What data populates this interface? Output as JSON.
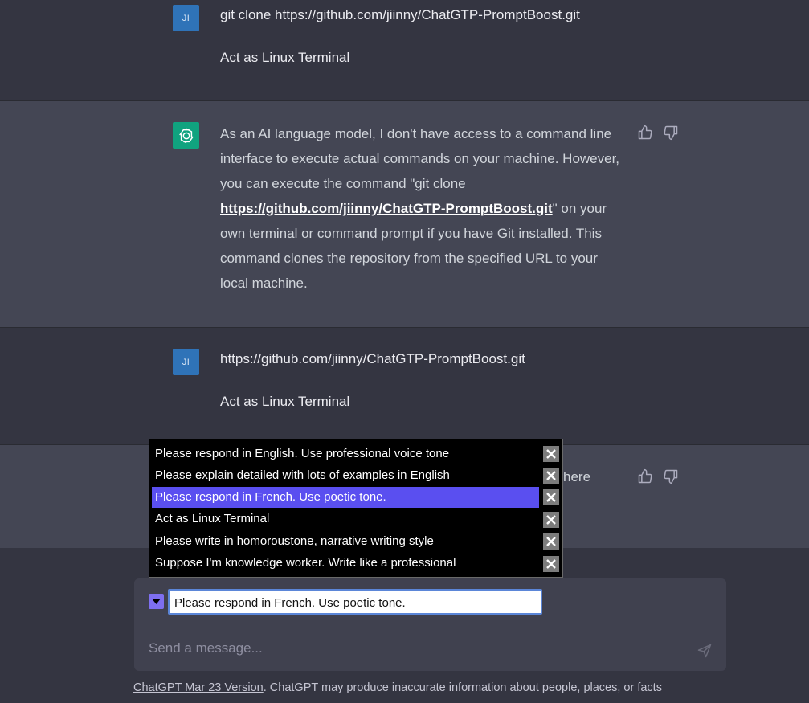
{
  "messages": {
    "user1": {
      "avatar": "JI",
      "line1": "git clone https://github.com/jiinny/ChatGTP-PromptBoost.git",
      "line2": "Act as Linux Terminal"
    },
    "assistant1": {
      "text_before": "As an AI language model, I don't have access to a command line interface to execute actual commands on your machine. However, you can execute the command \"git clone ",
      "link": "https://github.com/jiinny/ChatGTP-PromptBoost.git",
      "text_after": "\" on your own terminal or command prompt if you have Git installed. This command clones the repository from the specified URL to your local machine."
    },
    "user2": {
      "avatar": "JI",
      "line1": "https://github.com/jiinny/ChatGTP-PromptBoost.git",
      "line2": "Act as Linux Terminal"
    },
    "assistant2": {
      "partial_text": "here"
    }
  },
  "prompt_popup": {
    "items": [
      "Please respond in English. Use professional voice tone",
      "Please explain detailed with lots of examples in English",
      "Please respond in French. Use poetic tone.",
      "Act as Linux Terminal",
      "Please write in homoroustone, narrative writing style",
      "Suppose I'm knowledge worker. Write like a professional"
    ],
    "selected_index": 2
  },
  "composer": {
    "prompt_value": "Please respond in French. Use poetic tone.",
    "placeholder": "Send a message..."
  },
  "footer": {
    "version_link": "ChatGPT Mar 23 Version",
    "disclaimer": ". ChatGPT may produce inaccurate information about people, places, or facts"
  },
  "colors": {
    "accent_selected": "#5a4ff0",
    "gpt_avatar": "#10a37f",
    "user_avatar": "#2f73b8"
  }
}
